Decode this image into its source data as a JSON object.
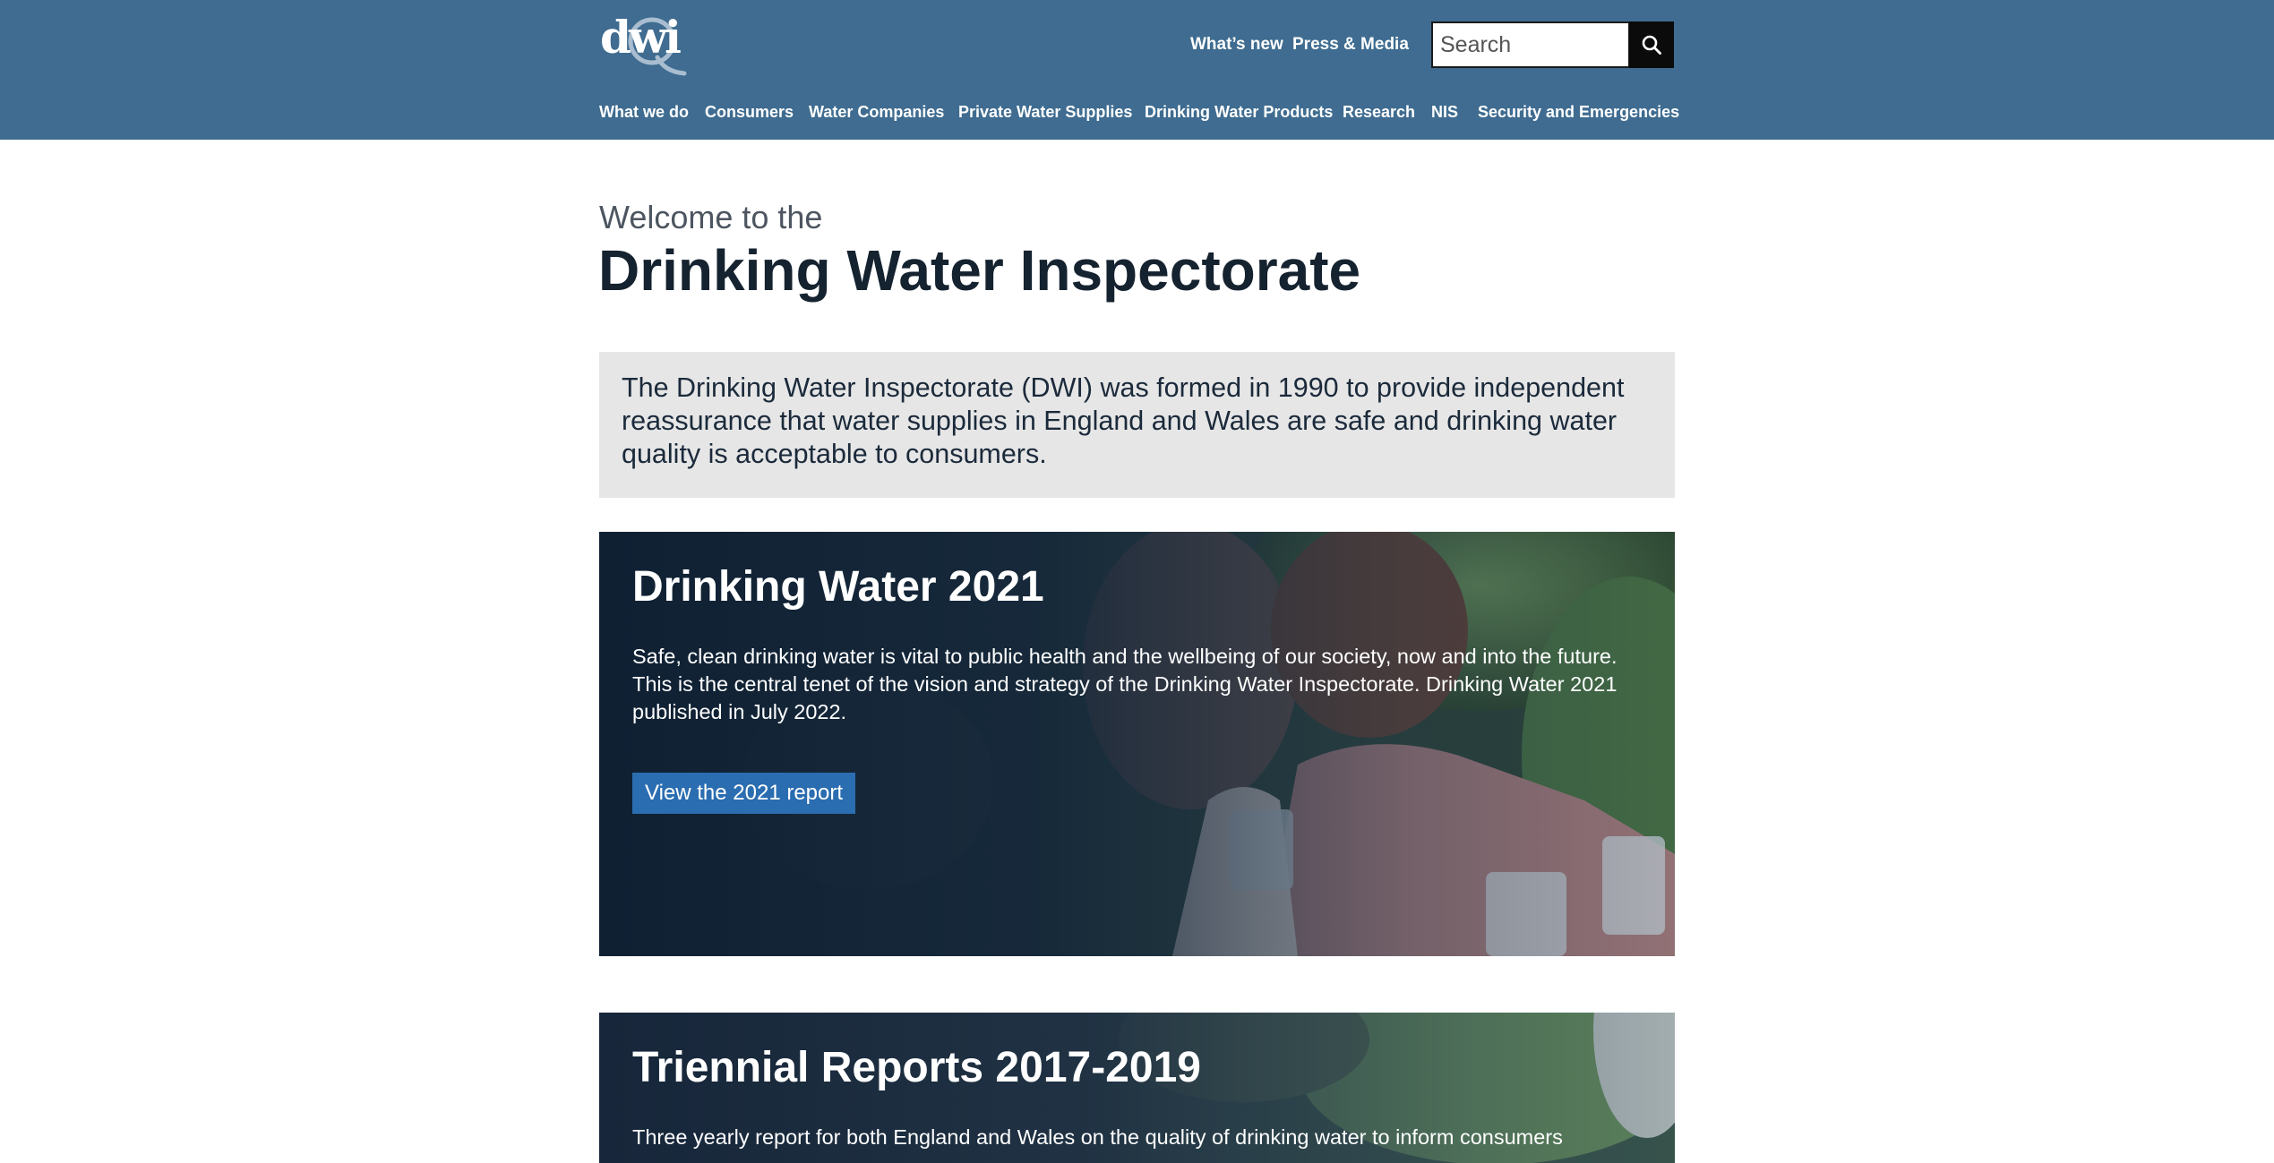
{
  "brand": {
    "logo_text": "dwi",
    "header_color": "#3f6c90"
  },
  "utility_nav": {
    "whats_new": "What’s new",
    "press_media": "Press & Media"
  },
  "search": {
    "placeholder": "Search",
    "icon": "search-icon"
  },
  "main_nav": [
    {
      "label": "What we do"
    },
    {
      "label": "Consumers"
    },
    {
      "label": "Water Companies"
    },
    {
      "label": "Private Water Supplies"
    },
    {
      "label": "Drinking Water Products"
    },
    {
      "label": "Research"
    },
    {
      "label": "NIS"
    },
    {
      "label": "Security and Emergencies"
    }
  ],
  "hero": {
    "welcome": "Welcome to the",
    "title": "Drinking Water Inspectorate"
  },
  "intro": {
    "text": "The Drinking Water Inspectorate (DWI) was formed in 1990 to provide independent reassurance that water supplies in England and Wales are safe and drinking water quality is acceptable to consumers."
  },
  "features": [
    {
      "title": "Drinking Water 2021",
      "text": "Safe, clean drinking water is vital to public health and the wellbeing of our society, now and into the future. This is the central tenet of the vision and strategy of the Drinking Water Inspectorate. Drinking Water 2021 published in July 2022.",
      "button": "View the 2021 report"
    },
    {
      "title": "Triennial Reports 2017-2019",
      "text": "Three yearly report for both England and Wales on the quality of drinking water to inform consumers"
    }
  ],
  "colors": {
    "button_blue": "#2a6db0",
    "card_dark": "#0f2033",
    "intro_bg": "#e6e6e6"
  }
}
